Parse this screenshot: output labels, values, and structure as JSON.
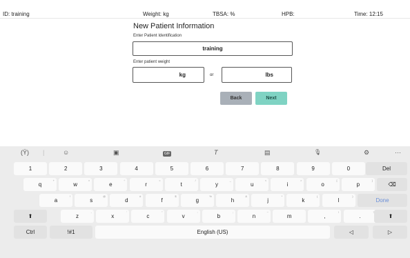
{
  "header": {
    "id": "ID: training",
    "weight": "Weight: kg",
    "tbsa": "TBSA: %",
    "hpb": "HPB:",
    "time": "Time: 12:15"
  },
  "form": {
    "title": "New Patient Information",
    "id_label": "Enter Patient Identification",
    "id_value": "training",
    "weight_label": "Enter patient weight",
    "kg_unit": "kg",
    "or_label": "or",
    "lbs_unit": "lbs",
    "back_label": "Back",
    "next_label": "Next"
  },
  "keyboard": {
    "toolbar": [
      "(Ÿ)",
      "|",
      "☺",
      "▣",
      "GIF",
      "T",
      "▤",
      "🎙",
      "⚙",
      "···"
    ],
    "row1": [
      "1",
      "2",
      "3",
      "4",
      "5",
      "6",
      "7",
      "8",
      "9",
      "0"
    ],
    "row1_last": "Del",
    "row2": [
      "q",
      "w",
      "e",
      "r",
      "t",
      "y",
      "u",
      "i",
      "o",
      "p"
    ],
    "row2_sup": [
      "+",
      "×",
      "÷",
      "=",
      "/",
      "_",
      "<",
      ">",
      "[",
      "]"
    ],
    "row2_last": "⌫",
    "row3": [
      "a",
      "s",
      "d",
      "f",
      "g",
      "h",
      "j",
      "k",
      "l"
    ],
    "row3_sup": [
      "!",
      "@",
      "#",
      "$",
      "%",
      "&",
      "*",
      "(",
      ")"
    ],
    "row3_last": "Done",
    "row4_shift": "⬆",
    "row4": [
      "z",
      "x",
      "c",
      "v",
      "b",
      "n",
      "m",
      ",",
      "."
    ],
    "row4_sup": [
      "-",
      "'",
      "\"",
      ":",
      ";",
      "~",
      "",
      "!",
      "?"
    ],
    "row4_extra": "?",
    "row4_shift2": "⬆",
    "row5": {
      "ctrl": "Ctrl",
      "sym": "!#1",
      "space": "English (US)",
      "left": "◁",
      "right": "▷"
    }
  }
}
